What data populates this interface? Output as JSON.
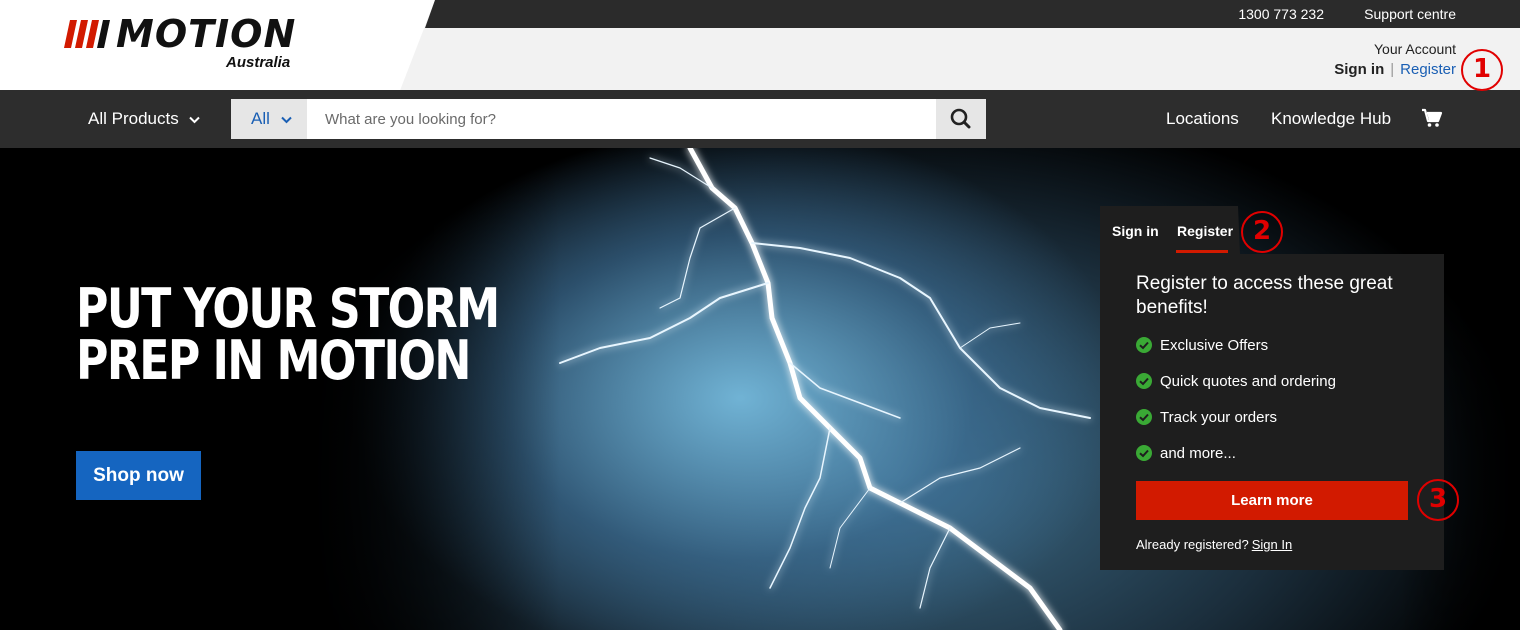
{
  "brand": {
    "logo_text": "MOTION",
    "logo_sub": "Australia"
  },
  "utility": {
    "phone": "1300 773 232",
    "support": "Support centre"
  },
  "account": {
    "label": "Your Account",
    "signin": "Sign in",
    "separator": "|",
    "register": "Register"
  },
  "nav": {
    "all_products": "All Products",
    "search_scope": "All",
    "search_placeholder": "What are you looking for?",
    "locations": "Locations",
    "knowledge_hub": "Knowledge Hub"
  },
  "hero": {
    "title_line1": "PUT YOUR STORM",
    "title_line2": "PREP IN MOTION",
    "cta": "Shop now"
  },
  "register_panel": {
    "tab_signin": "Sign in",
    "tab_register": "Register",
    "heading": "Register to access these great benefits!",
    "benefits": [
      "Exclusive Offers",
      "Quick quotes and ordering",
      "Track your orders",
      "and more..."
    ],
    "learn_more": "Learn more",
    "already_text": "Already registered?",
    "already_link": "Sign In"
  },
  "markers": [
    "1",
    "2",
    "3"
  ],
  "colors": {
    "accent_red": "#d21a00",
    "link_blue": "#1a5fb4",
    "button_blue": "#1565c0",
    "check_green": "#3aa935",
    "marker_red": "#e10000"
  },
  "icons": [
    "chevron-down-icon",
    "search-icon",
    "cart-icon",
    "check-icon"
  ]
}
